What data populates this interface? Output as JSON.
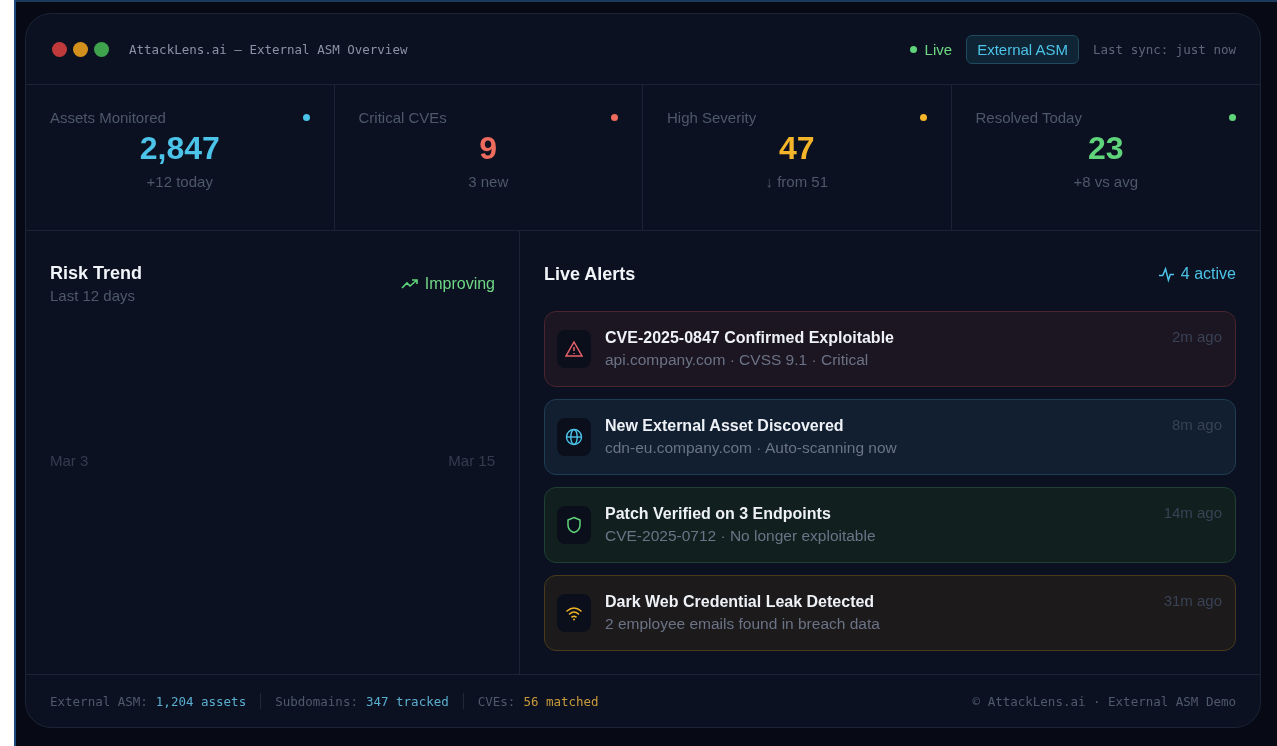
{
  "window": {
    "title": "AttackLens.ai — External ASM Overview",
    "controls": [
      {
        "color": "#c0393b"
      },
      {
        "color": "#d4901c"
      },
      {
        "color": "#3fa34d"
      }
    ]
  },
  "header": {
    "live": "Live",
    "badge": "External ASM",
    "sync": "Last sync: just now"
  },
  "stats": [
    {
      "label": "Assets Monitored",
      "value": "2,847",
      "note": "+12 today",
      "color": "#4cc3e8"
    },
    {
      "label": "Critical CVEs",
      "value": "9",
      "note": "3 new",
      "color": "#ef6b5e"
    },
    {
      "label": "High Severity",
      "value": "47",
      "note": "↓ from 51",
      "color": "#f5b52a"
    },
    {
      "label": "Resolved Today",
      "value": "23",
      "note": "+8 vs avg",
      "color": "#5fd47a"
    }
  ],
  "risk_trend": {
    "title": "Risk Trend",
    "subtitle": "Last 12 days",
    "status": "Improving",
    "start_label": "Mar 3",
    "end_label": "Mar 15"
  },
  "alerts_panel": {
    "title": "Live Alerts",
    "count": "4 active"
  },
  "alerts": [
    {
      "kind": "critical",
      "title": "CVE-2025-0847 Confirmed Exploitable",
      "detail": "api.company.com · CVSS 9.1 · Critical",
      "time": "2m ago"
    },
    {
      "kind": "discovery",
      "title": "New External Asset Discovered",
      "detail": "cdn-eu.company.com · Auto-scanning now",
      "time": "8m ago"
    },
    {
      "kind": "resolved",
      "title": "Patch Verified on 3 Endpoints",
      "detail": "CVE-2025-0712 · No longer exploitable",
      "time": "14m ago"
    },
    {
      "kind": "leak",
      "title": "Dark Web Credential Leak Detected",
      "detail": "2 employee emails found in breach data",
      "time": "31m ago"
    }
  ],
  "footer": {
    "items": [
      {
        "label": "External ASM:",
        "value": "1,204 assets",
        "color": "#5aaed0"
      },
      {
        "label": "Subdomains:",
        "value": "347 tracked",
        "color": "#5aaed0"
      },
      {
        "label": "CVEs:",
        "value": "56 matched",
        "color": "#c99a3a"
      }
    ],
    "copyright": "© AttackLens.ai · External ASM Demo"
  }
}
